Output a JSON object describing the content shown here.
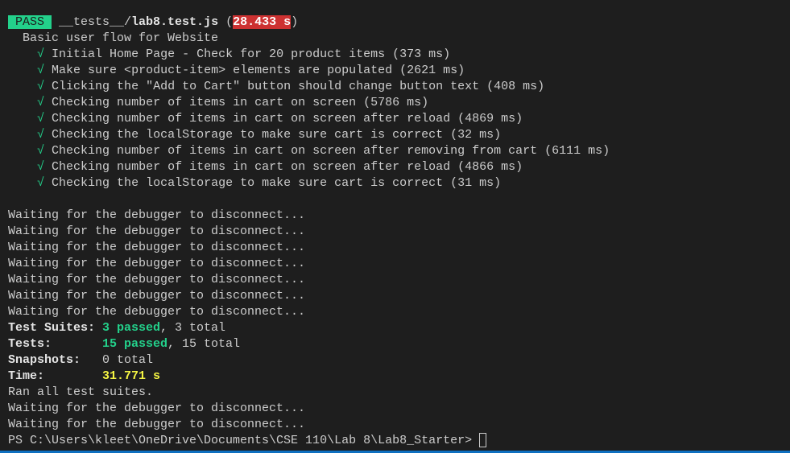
{
  "header": {
    "badge": "PASS",
    "path_dir": "__tests__/",
    "path_file": "lab8.test.js",
    "open": " (",
    "duration": "28.433 s",
    "close": ")"
  },
  "suite": "Basic user flow for Website",
  "check_glyph": "√",
  "tests": [
    "Initial Home Page - Check for 20 product items (373 ms)",
    "Make sure <product-item> elements are populated (2621 ms)",
    "Clicking the \"Add to Cart\" button should change button text (408 ms)",
    "Checking number of items in cart on screen (5786 ms)",
    "Checking number of items in cart on screen after reload (4869 ms)",
    "Checking the localStorage to make sure cart is correct (32 ms)",
    "Checking number of items in cart on screen after removing from cart (6111 ms)",
    "Checking number of items in cart on screen after reload (4866 ms)",
    "Checking the localStorage to make sure cart is correct (31 ms)"
  ],
  "waiting": "Waiting for the debugger to disconnect...",
  "summary": {
    "suites_label": "Test Suites: ",
    "suites_passed": "3 passed",
    "suites_total": ", 3 total",
    "tests_label": "Tests:       ",
    "tests_passed": "15 passed",
    "tests_total": ", 15 total",
    "snap_label": "Snapshots:   ",
    "snap_value": "0 total",
    "time_label": "Time:        ",
    "time_value": "31.771 s",
    "ran": "Ran all test suites."
  },
  "prompt": "PS C:\\Users\\kleet\\OneDrive\\Documents\\CSE 110\\Lab 8\\Lab8_Starter> ",
  "colors": {
    "background": "#1e1e1e",
    "text": "#cccccc",
    "pass": "#23d18b",
    "fail_bg": "#cd3131",
    "time": "#f5f543"
  }
}
